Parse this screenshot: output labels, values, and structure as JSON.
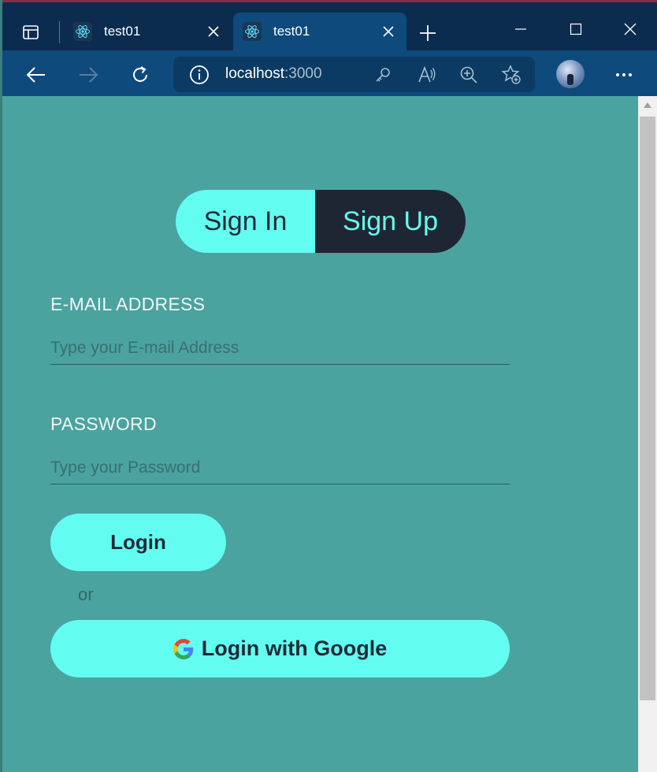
{
  "browser": {
    "tabs": [
      {
        "title": "test01",
        "active": false
      },
      {
        "title": "test01",
        "active": true
      }
    ],
    "address": {
      "host": "localhost",
      "port": ":3000"
    }
  },
  "auth": {
    "toggle": {
      "sign_in": "Sign In",
      "sign_up": "Sign Up",
      "selected": "Sign Up"
    },
    "email": {
      "label": "E-MAIL ADDRESS",
      "placeholder": "Type your E-mail Address",
      "value": ""
    },
    "password": {
      "label": "PASSWORD",
      "placeholder": "Type your Password",
      "value": ""
    },
    "login_button": "Login",
    "or_text": "or",
    "google_button": "Login with Google"
  },
  "colors": {
    "background": "#4aa39f",
    "accent": "#63fcf1",
    "dark": "#1f2633",
    "browser_frame": "#0f4a7c"
  }
}
